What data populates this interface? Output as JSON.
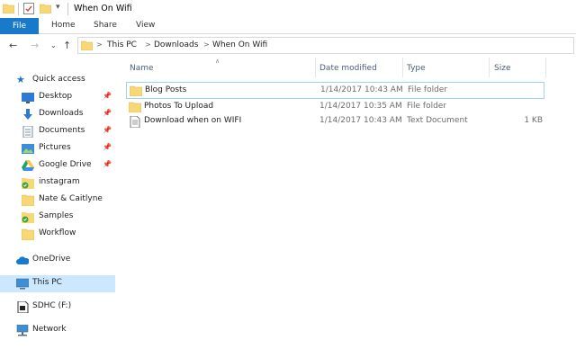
{
  "window": {
    "title": "When On Wifi"
  },
  "ribbon": {
    "file": "File",
    "tabs": [
      "Home",
      "Share",
      "View"
    ]
  },
  "address": {
    "crumbs": [
      "This PC",
      "Downloads",
      "When On Wifi"
    ],
    "separator": ">"
  },
  "nav": {
    "quick_access": "Quick access",
    "quick_items": [
      {
        "label": "Desktop",
        "icon": "desktop-icon",
        "pinned": true
      },
      {
        "label": "Downloads",
        "icon": "download-arrow-icon",
        "pinned": true
      },
      {
        "label": "Documents",
        "icon": "documents-icon",
        "pinned": true
      },
      {
        "label": "Pictures",
        "icon": "pictures-icon",
        "pinned": true
      },
      {
        "label": "Google Drive",
        "icon": "google-drive-icon",
        "pinned": true
      },
      {
        "label": "instagram",
        "icon": "synced-folder-icon",
        "pinned": false
      },
      {
        "label": "Nate & Caitlyne",
        "icon": "folder-icon",
        "pinned": false
      },
      {
        "label": "Samples",
        "icon": "synced-folder-icon",
        "pinned": false
      },
      {
        "label": "Workflow",
        "icon": "folder-icon",
        "pinned": false
      }
    ],
    "onedrive": "OneDrive",
    "this_pc": "This PC",
    "sdhc": "SDHC (F:)",
    "network": "Network",
    "selected": "This PC"
  },
  "columns": {
    "name": "Name",
    "date": "Date modified",
    "type": "Type",
    "size": "Size"
  },
  "files": [
    {
      "name": "Blog Posts",
      "date": "1/14/2017 10:43 AM",
      "type": "File folder",
      "size": "",
      "icon": "folder-icon"
    },
    {
      "name": "Photos To Upload",
      "date": "1/14/2017 10:35 AM",
      "type": "File folder",
      "size": "",
      "icon": "folder-icon"
    },
    {
      "name": "Download when on WIFI",
      "date": "1/14/2017 10:43 AM",
      "type": "Text Document",
      "size": "1 KB",
      "icon": "text-document-icon"
    }
  ],
  "colors": {
    "file_tab": "#1979ca",
    "folder": "#f8d775",
    "selection": "#cce8ff",
    "focus_border": "#99d1ff"
  }
}
